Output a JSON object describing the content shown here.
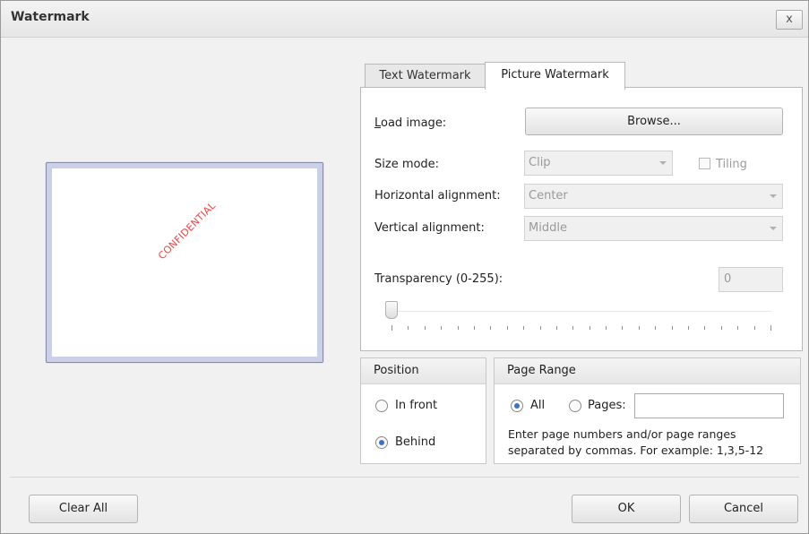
{
  "window": {
    "title": "Watermark",
    "close_label": "x"
  },
  "preview": {
    "watermark_text": "CONFIDENTIAL",
    "watermark_color": "#ff4040"
  },
  "tabs": [
    {
      "label": "Text Watermark",
      "selected": false
    },
    {
      "label": "Picture Watermark",
      "selected": true
    }
  ],
  "picture": {
    "load_image_label": "Load image:",
    "browse_label": "Browse...",
    "size_mode_label": "Size mode:",
    "size_mode_value": "Clip",
    "tiling_label": "Tiling",
    "tiling_checked": false,
    "horizontal_label": "Horizontal alignment:",
    "horizontal_value": "Center",
    "vertical_label": "Vertical alignment:",
    "vertical_value": "Middle",
    "transparency_label": "Transparency (0-255):",
    "transparency_value": "0",
    "transparency_fraction": 0.0
  },
  "position": {
    "title": "Position",
    "options": [
      {
        "label": "In front",
        "selected": false
      },
      {
        "label": "Behind",
        "selected": true
      }
    ]
  },
  "page_range": {
    "title": "Page Range",
    "all_label": "All",
    "pages_label": "Pages:",
    "pages_value": "",
    "selected": "All",
    "hint_line1": "Enter page numbers and/or page ranges",
    "hint_line2": "separated by commas. For example: 1,3,5-12"
  },
  "buttons": {
    "clear_all": "Clear All",
    "ok": "OK",
    "cancel": "Cancel"
  },
  "colors": {
    "accent_radio": "#3b73c8",
    "preview_frame": "#c9d0e8"
  }
}
